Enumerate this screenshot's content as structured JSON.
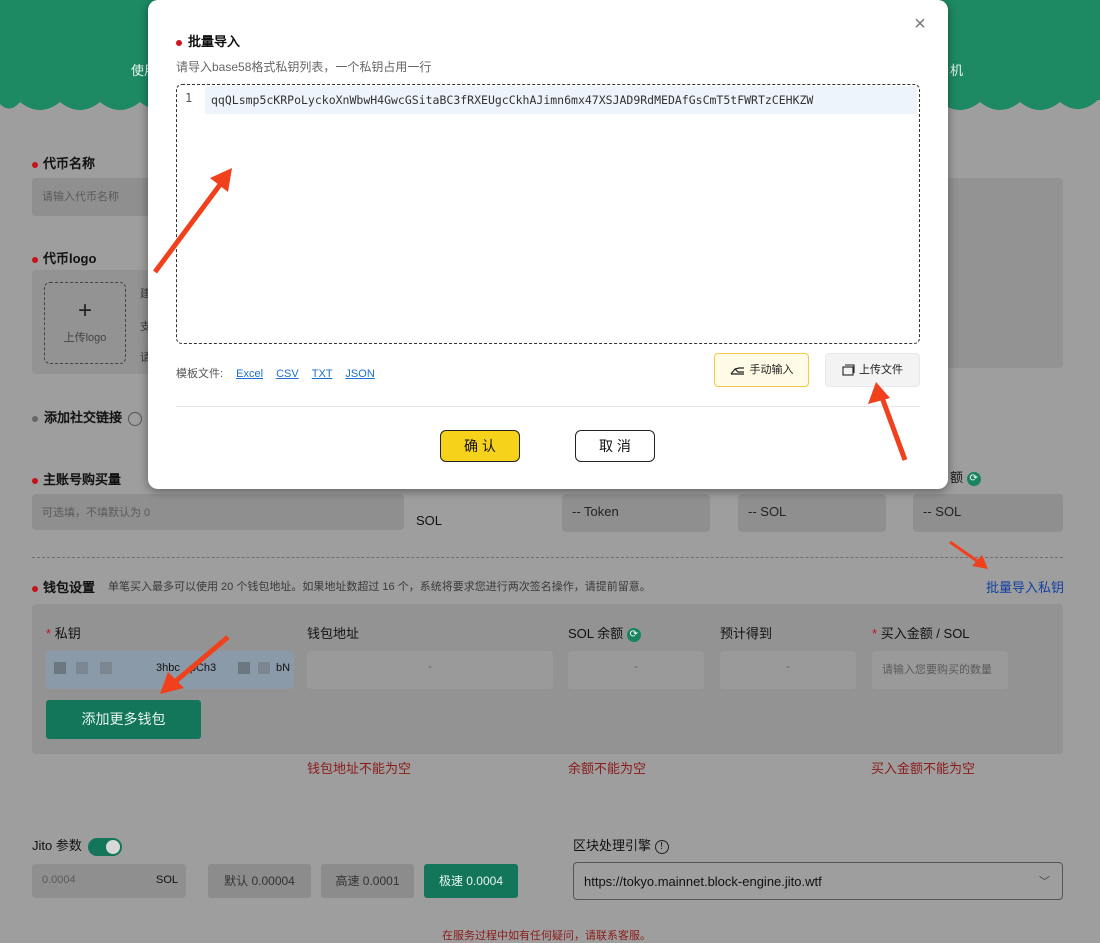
{
  "banner": {
    "left_text": "使用",
    "right_text": "机"
  },
  "token_name": {
    "label": "代币名称",
    "placeholder": "请输入代币名称"
  },
  "token_logo": {
    "label": "代币logo",
    "upload_label": "上传logo",
    "side_chars": [
      "建",
      "支",
      "请"
    ]
  },
  "social_links": {
    "label": "添加社交链接"
  },
  "main_buy": {
    "label": "主账号购买量",
    "placeholder": "可选填，不填默认为 0",
    "unit": "SOL"
  },
  "summary": {
    "token_value": "-- Token",
    "sol_value": "-- SOL",
    "sol_value2": "-- SOL",
    "balance_label_suffix": "额"
  },
  "wallet_settings": {
    "label": "钱包设置",
    "note": "单笔买入最多可以使用 20 个钱包地址。如果地址数超过 16 个，系统将要求您进行两次签名操作，请提前留意。",
    "bulk_import_link": "批量导入私钥",
    "columns": {
      "private_key": "私钥",
      "wallet_address": "钱包地址",
      "sol_balance": "SOL 余额",
      "expected": "预计得到",
      "buy_amount": "买入金额 / SOL"
    },
    "row": {
      "key_partial_a": "3hbc",
      "key_partial_b": "pCh3",
      "key_partial_c": "bN",
      "address": "-",
      "balance": "-",
      "expected": "-",
      "amount_placeholder": "请输入您要购买的数量"
    },
    "add_more_button": "添加更多钱包",
    "errors": {
      "address": "钱包地址不能为空",
      "balance": "余额不能为空",
      "amount": "买入金额不能为空"
    }
  },
  "jito": {
    "label": "Jito 参数",
    "value": "0.0004",
    "unit": "SOL",
    "options": [
      "默认 0.00004",
      "高速 0.0001",
      "极速 0.0004"
    ]
  },
  "block_engine": {
    "label": "区块处理引擎",
    "value": "https://tokyo.mainnet.block-engine.jito.wtf"
  },
  "footer": {
    "text": "在服务过程中如有任何疑问，请联系客服。"
  },
  "modal": {
    "title": "批量导入",
    "description": "请导入base58格式私钥列表，一个私钥占用一行",
    "line_number": "1",
    "key_value": "qqQLsmp5cKRPoLyckoXnWbwH4GwcGSitaBC3fRXEUgcCkhAJimn6mx47XSJAD9RdMEDAfGsCmT5tFWRTzCEHKZW",
    "template_label": "模板文件:",
    "templates": [
      "Excel",
      "CSV",
      "TXT",
      "JSON"
    ],
    "manual_input": "手动输入",
    "upload_file": "上传文件",
    "confirm": "确 认",
    "cancel": "取 消",
    "close_icon": "×"
  },
  "colors": {
    "accent": "#13765a",
    "error": "#c4141b",
    "confirm": "#f7d21a",
    "arrow": "#f0401c"
  }
}
